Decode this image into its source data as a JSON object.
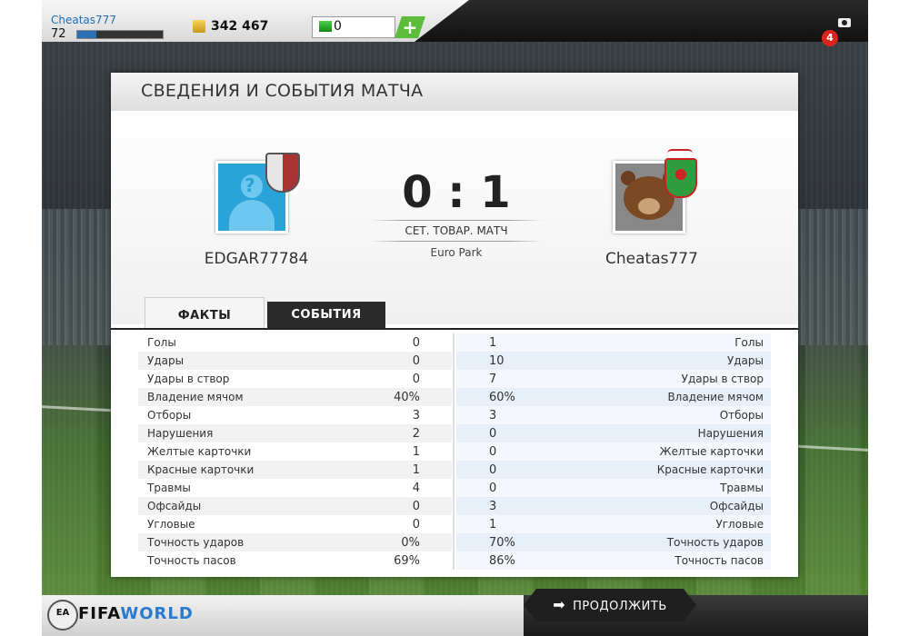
{
  "topbar": {
    "username": "Cheatas777",
    "level": "72",
    "xp_fraction": 0.22,
    "coins": "342 467",
    "points": "0",
    "plus_label": "+",
    "notifications": "4"
  },
  "panel": {
    "title": "СВЕДЕНИЯ И СОБЫТИЯ МАТЧА",
    "home_team": "EDGAR77784",
    "away_team": "Cheatas777",
    "score": "0 : 1",
    "match_type": "СЕТ. ТОВАР. МАТЧ",
    "venue": "Euro Park",
    "tabs": {
      "facts": "ФАКТЫ",
      "events": "СОБЫТИЯ"
    }
  },
  "stats": [
    {
      "label": "Голы",
      "home": "0",
      "away": "1"
    },
    {
      "label": "Удары",
      "home": "0",
      "away": "10"
    },
    {
      "label": "Удары в створ",
      "home": "0",
      "away": "7"
    },
    {
      "label": "Владение мячом",
      "home": "40%",
      "away": "60%"
    },
    {
      "label": "Отборы",
      "home": "3",
      "away": "3"
    },
    {
      "label": "Нарушения",
      "home": "2",
      "away": "0"
    },
    {
      "label": "Желтые карточки",
      "home": "1",
      "away": "0"
    },
    {
      "label": "Красные карточки",
      "home": "1",
      "away": "0"
    },
    {
      "label": "Травмы",
      "home": "4",
      "away": "0"
    },
    {
      "label": "Офсайды",
      "home": "0",
      "away": "3"
    },
    {
      "label": "Угловые",
      "home": "0",
      "away": "1"
    },
    {
      "label": "Точность ударов",
      "home": "0%",
      "away": "70%"
    },
    {
      "label": "Точность пасов",
      "home": "69%",
      "away": "86%"
    }
  ],
  "footer": {
    "brand_fifa": "FIFA",
    "brand_world": "WORLD",
    "ea_label": "EA",
    "continue_label": "ПРОДОЛЖИТЬ",
    "continue_arrow": "➡"
  }
}
